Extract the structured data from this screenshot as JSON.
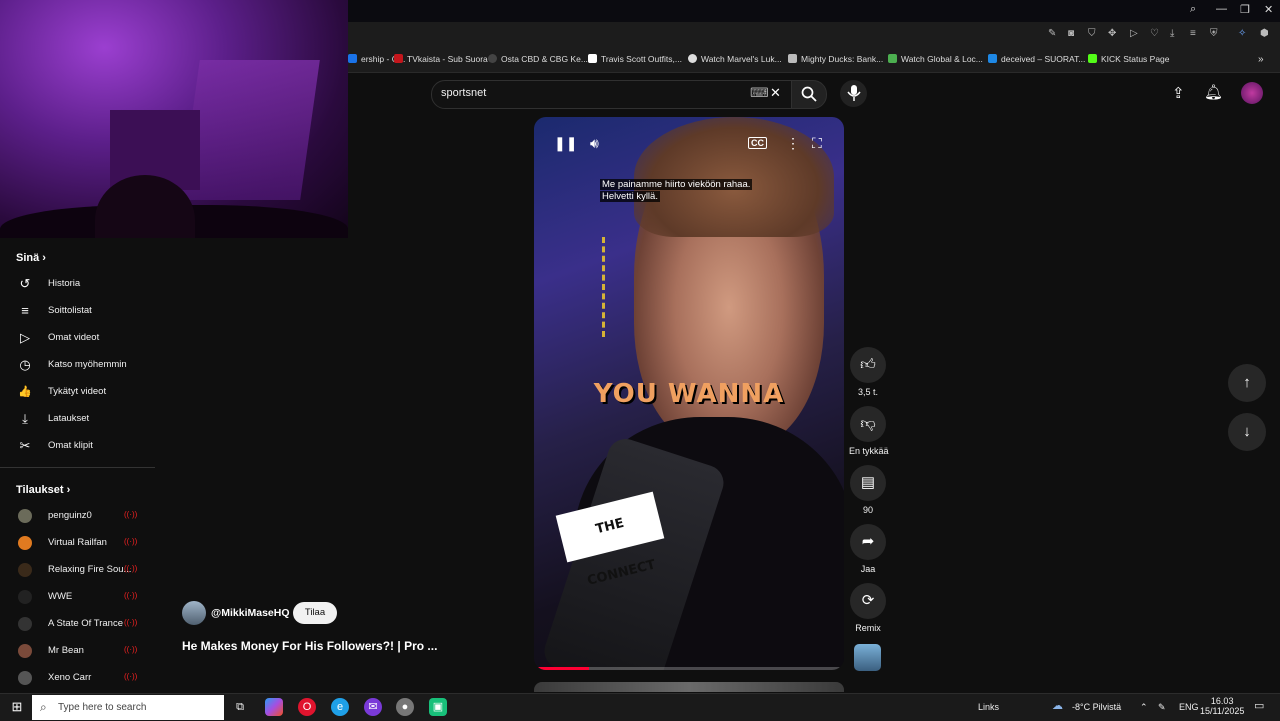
{
  "browser": {
    "bookmarks": [
      {
        "label": "ership - G...",
        "color": "#1a73e8"
      },
      {
        "label": "TVkaista - Sub Suora",
        "color": "#c4161c"
      },
      {
        "label": "Osta CBD & CBG Ke...",
        "color": "#444444"
      },
      {
        "label": "Travis Scott Outfits,...",
        "color": "#ffffff"
      },
      {
        "label": "Watch Marvel's Luk...",
        "color": "#dddddd"
      },
      {
        "label": "Mighty Ducks: Bank...",
        "color": "#bbbbbb"
      },
      {
        "label": "Watch Global & Loc...",
        "color": "#4caf50"
      },
      {
        "label": "deceived – SUORAT...",
        "color": "#1e88e5"
      },
      {
        "label": "KICK Status Page",
        "color": "#53fc18"
      }
    ],
    "overflow_icon": "chevron-right-double-icon"
  },
  "header": {
    "search_value": "sportsnet",
    "keyboard_icon": "⌨",
    "clear_icon": "✕"
  },
  "sidebar": {
    "you_label": "Sinä",
    "you_items": [
      {
        "label": "Historia",
        "icon": "history-icon",
        "glyph": "↺"
      },
      {
        "label": "Soittolistat",
        "icon": "playlist-icon",
        "glyph": "≡"
      },
      {
        "label": "Omat videot",
        "icon": "your-videos-icon",
        "glyph": "▷"
      },
      {
        "label": "Katso myöhemmin",
        "icon": "watch-later-icon",
        "glyph": "◷"
      },
      {
        "label": "Tykätyt videot",
        "icon": "liked-videos-icon",
        "glyph": "👍"
      },
      {
        "label": "Lataukset",
        "icon": "downloads-icon",
        "glyph": "⤓"
      },
      {
        "label": "Omat klipit",
        "icon": "clips-icon",
        "glyph": "✂"
      }
    ],
    "subs_label": "Tilaukset",
    "subscriptions": [
      {
        "label": "penguinz0",
        "color": "#6b6b5a",
        "live": true
      },
      {
        "label": "Virtual Railfan",
        "color": "#e07a20",
        "live": true
      },
      {
        "label": "Relaxing Fire Sou...",
        "color": "#3a2a1a",
        "live": true
      },
      {
        "label": "WWE",
        "color": "#222222",
        "live": true
      },
      {
        "label": "A State Of Trance",
        "color": "#333333",
        "live": true
      },
      {
        "label": "Mr Bean",
        "color": "#7a4a3a",
        "live": true
      },
      {
        "label": "Xeno Carr",
        "color": "#555555",
        "live": true
      }
    ],
    "live_glyph": "((·))"
  },
  "video": {
    "caption_line1": "Me painamme hiirto vieköön rahaa.",
    "caption_line2": "Helvetti kyllä.",
    "overlay_word": "YOU WANNA",
    "brand_text": "THE CONNECT",
    "progress": 0.17,
    "channel": "@MikkiMaseHQ",
    "subscribe_label": "Tilaa",
    "title": "He Makes Money For His Followers?! | Pro ..."
  },
  "actions": {
    "like_count": "3,5 t.",
    "dislike_label": "En tykkää",
    "comments_count": "90",
    "share_label": "Jaa",
    "remix_label": "Remix"
  },
  "taskbar": {
    "search_placeholder": "Type here to search",
    "links_label": "Links",
    "weather": "-8°C  Pilvistä",
    "language": "ENG",
    "time": "16.03",
    "date": "15/11/2025"
  }
}
